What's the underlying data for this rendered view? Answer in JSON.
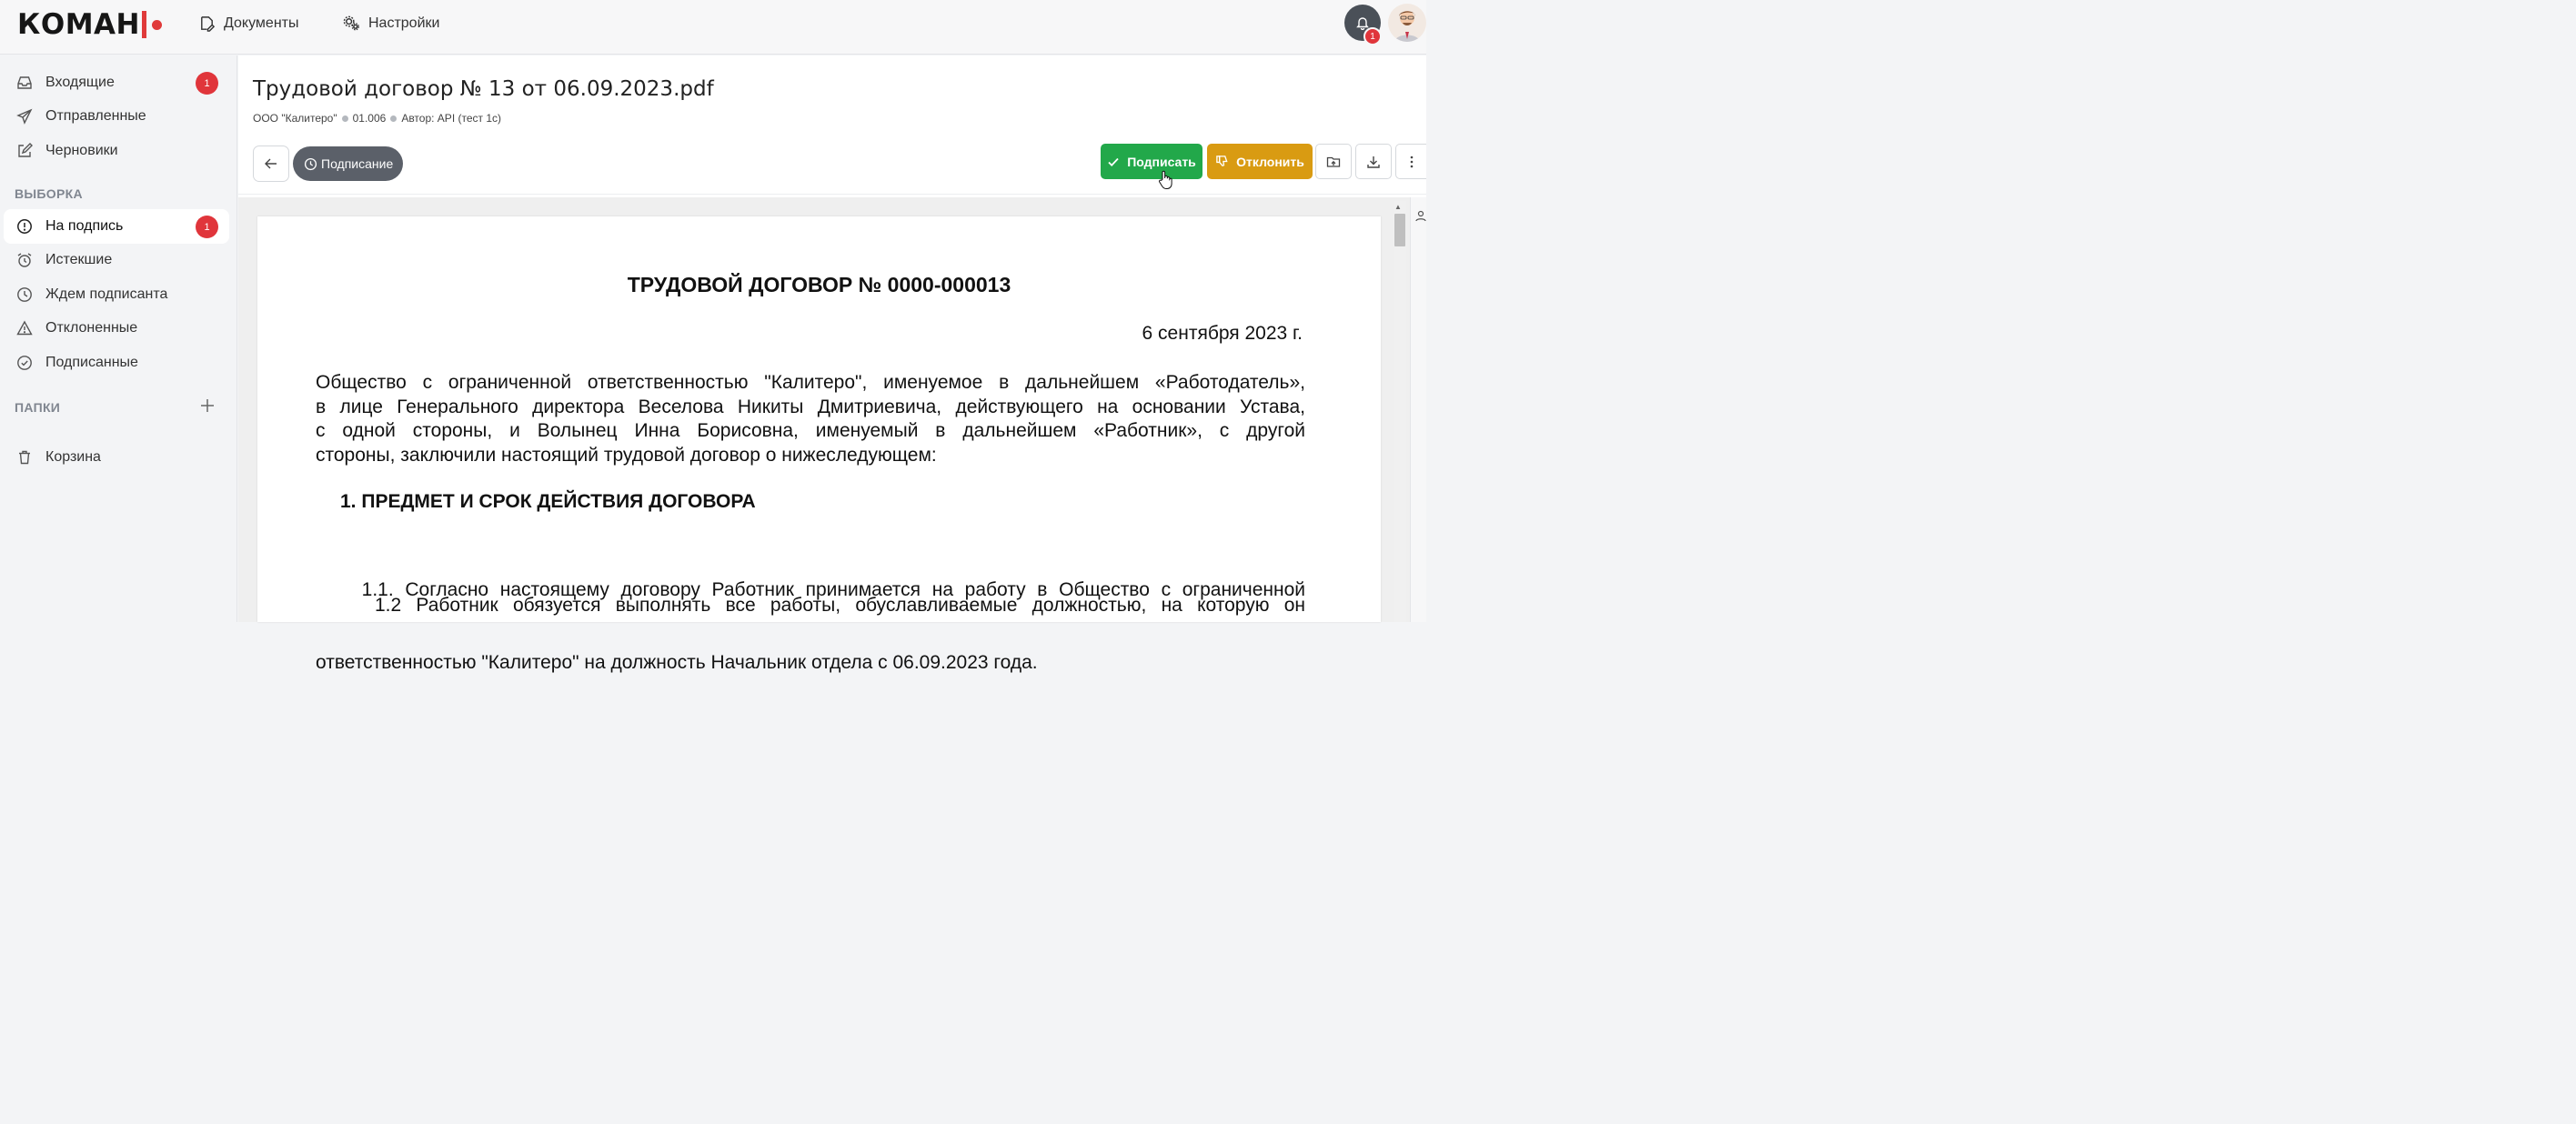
{
  "header": {
    "logo_text": "КОМАН",
    "nav": [
      {
        "label": "Документы",
        "icon": "document-edit-icon"
      },
      {
        "label": "Настройки",
        "icon": "gears-icon"
      }
    ],
    "notifications_count": "1"
  },
  "sidebar": {
    "mail": [
      {
        "label": "Входящие",
        "icon": "inbox-icon",
        "badge": "1"
      },
      {
        "label": "Отправленные",
        "icon": "send-icon"
      },
      {
        "label": "Черновики",
        "icon": "edit-icon"
      }
    ],
    "selection_heading": "ВЫБОРКА",
    "selection": [
      {
        "label": "На подпись",
        "icon": "alert-circle-icon",
        "badge": "1",
        "active": true
      },
      {
        "label": "Истекшие",
        "icon": "alarm-clock-icon"
      },
      {
        "label": "Ждем подписанта",
        "icon": "clock-icon"
      },
      {
        "label": "Отклоненные",
        "icon": "warning-triangle-icon"
      },
      {
        "label": "Подписанные",
        "icon": "check-circle-icon"
      }
    ],
    "folders_heading": "ПАПКИ",
    "trash_label": "Корзина"
  },
  "document": {
    "title": "Трудовой договор № 13 от 06.09.2023.pdf",
    "company": "ООО \"Калитеро\"",
    "code": "01.006",
    "author": "Автор: API (тест 1с)",
    "status": "Подписание"
  },
  "actions": {
    "sign_label": "Подписать",
    "reject_label": "Отклонить"
  },
  "colors": {
    "accent_red": "#e03a3a",
    "sign_green": "#22a84a",
    "reject_amber": "#d99b12",
    "status_gray": "#5b6069"
  },
  "pdf": {
    "title": "ТРУДОВОЙ ДОГОВОР № 0000-000013",
    "date": "6 сентября 2023 г.",
    "intro_lines": [
      "Общество с ограниченной ответственностью \"Калитеро\", именуемое в дальнейшем «Работодатель»,",
      "в лице Генерального директора Веселова Никиты Дмитриевича, действующего на основании Устава,",
      "с одной стороны, и Волынец Инна Борисовна, именуемый в дальнейшем «Работник», с другой",
      "стороны, заключили настоящий трудовой договор о нижеследующем:"
    ],
    "section1_heading": "1. ПРЕДМЕТ И СРОК ДЕЙСТВИЯ ДОГОВОРА",
    "clause_1_1_lines": [
      "    1.1. Согласно настоящему договору Работник принимается на работу в Общество с ограниченной",
      "ответственностью \"Калитеро\" на должность Начальник отдела с 06.09.2023 года."
    ],
    "clause_1_2_line": "    1.2 Работник обязуется выполнять все работы, обуславливаемые должностью, на которую он"
  }
}
